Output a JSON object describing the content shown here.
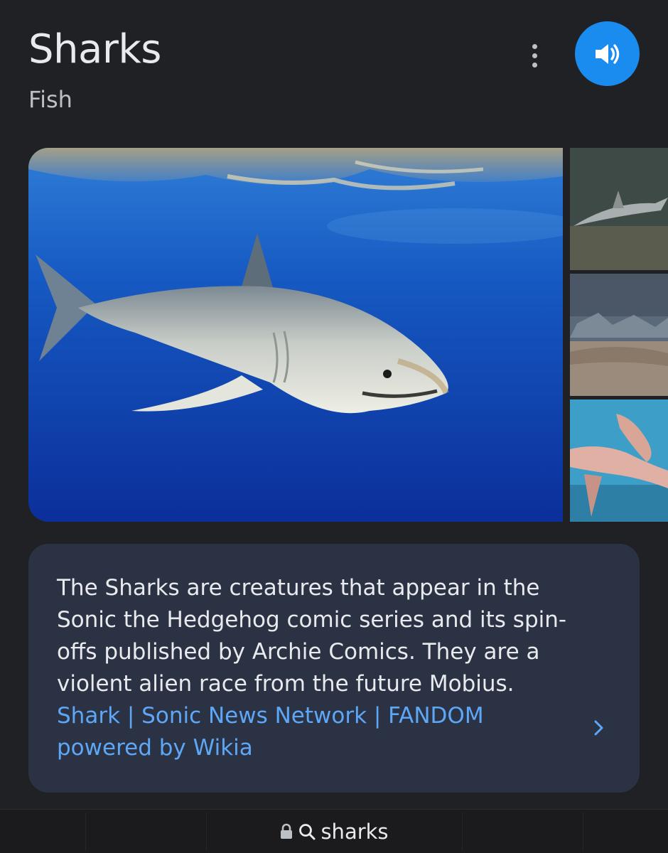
{
  "header": {
    "title": "Sharks",
    "subtitle": "Fish",
    "more_icon": "more-vert-icon",
    "speaker_icon": "volume-up-icon",
    "speaker_color": "#1a8cf0"
  },
  "images": {
    "main": "great white shark swimming underwater",
    "side": [
      "small shark near sea floor",
      "flat shark on rocky bottom",
      "hammerhead shark in blue water"
    ]
  },
  "description": {
    "text": "The Sharks are creatures that appear in the Sonic the Hedgehog comic series and its spin-offs published by Archie Comics. They are a violent alien race from the future Mobius.",
    "link_text": "Shark | Sonic News Network | FANDOM powered by Wikia",
    "link_color": "#5ea7f7",
    "chevron_icon": "chevron-right-icon"
  },
  "address_bar": {
    "lock_icon": "lock-icon",
    "search_icon": "search-icon",
    "query": "sharks"
  }
}
